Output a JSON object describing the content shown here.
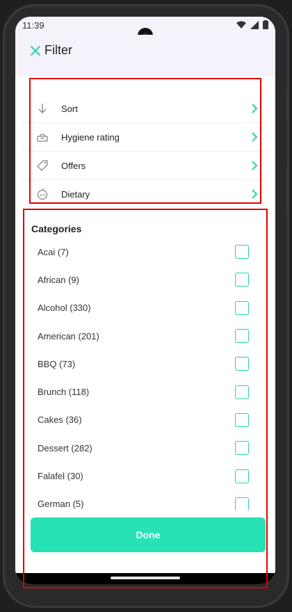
{
  "status_bar": {
    "time": "11:39"
  },
  "header": {
    "title": "Filter"
  },
  "menu": {
    "items": [
      {
        "label": "Sort",
        "icon": "arrow-down-icon"
      },
      {
        "label": "Hygiene rating",
        "icon": "hygiene-icon"
      },
      {
        "label": "Offers",
        "icon": "tag-icon"
      },
      {
        "label": "Dietary",
        "icon": "apple-icon"
      }
    ]
  },
  "categories": {
    "title": "Categories",
    "items": [
      "Acai (7)",
      "African (9)",
      "Alcohol (330)",
      "American (201)",
      "BBQ (73)",
      "Brunch (118)",
      "Cakes (36)",
      "Dessert (282)",
      "Falafel (30)",
      "German (5)"
    ]
  },
  "footer": {
    "done_label": "Done"
  },
  "colors": {
    "accent": "#27e2b4",
    "checkbox": "#27d3a9",
    "highlight": "#e00000"
  }
}
